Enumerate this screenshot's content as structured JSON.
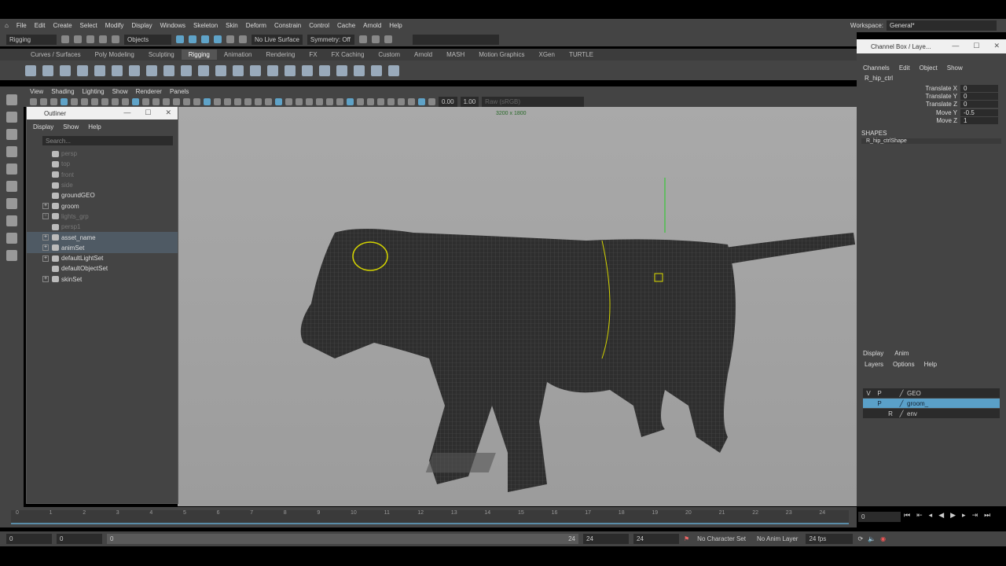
{
  "menubar": {
    "items": [
      "File",
      "Edit",
      "Create",
      "Select",
      "Modify",
      "Display",
      "Windows",
      "Skeleton",
      "Skin",
      "Deform",
      "Constrain",
      "Control",
      "Cache",
      "Arnold",
      "Help"
    ],
    "workspace_label": "Workspace:",
    "workspace_value": "General*"
  },
  "status": {
    "mode": "Rigging",
    "objects": "Objects",
    "live_surface": "No Live Surface",
    "symmetry": "Symmetry: Off"
  },
  "shelf": {
    "tabs": [
      "Curves / Surfaces",
      "Poly Modeling",
      "Sculpting",
      "Rigging",
      "Animation",
      "Rendering",
      "FX",
      "FX Caching",
      "Custom",
      "Arnold",
      "MASH",
      "Motion Graphics",
      "XGen",
      "TURTLE"
    ],
    "active": "Rigging"
  },
  "panel": {
    "menu": [
      "View",
      "Shading",
      "Lighting",
      "Show",
      "Renderer",
      "Panels"
    ],
    "exposure": "0.00",
    "gamma": "1.00",
    "colorspace": "Raw (sRGB)",
    "resolution": "3200 x 1800"
  },
  "outliner": {
    "title": "Outliner",
    "menu": [
      "Display",
      "Show",
      "Help"
    ],
    "search_placeholder": "Search...",
    "items": [
      {
        "label": "persp",
        "dim": true,
        "exp": false
      },
      {
        "label": "top",
        "dim": true,
        "exp": false
      },
      {
        "label": "front",
        "dim": true,
        "exp": false
      },
      {
        "label": "side",
        "dim": true,
        "exp": false
      },
      {
        "label": "groundGEO",
        "dim": false,
        "exp": false
      },
      {
        "label": "groom",
        "dim": false,
        "exp": true
      },
      {
        "label": "lights_grp",
        "dim": true,
        "exp": true
      },
      {
        "label": "persp1",
        "dim": true,
        "exp": false
      },
      {
        "label": "asset_name",
        "dim": false,
        "exp": true,
        "sel": true
      },
      {
        "label": "animSet",
        "dim": false,
        "exp": true,
        "sel": true
      },
      {
        "label": "defaultLightSet",
        "dim": false,
        "exp": true
      },
      {
        "label": "defaultObjectSet",
        "dim": false,
        "exp": false
      },
      {
        "label": "skinSet",
        "dim": false,
        "exp": true
      }
    ]
  },
  "channelbox": {
    "title": "Channel Box / Laye...",
    "menu": [
      "Channels",
      "Edit",
      "Object",
      "Show"
    ],
    "object": "R_hip_ctrl",
    "channels": [
      {
        "label": "Translate X",
        "value": "0"
      },
      {
        "label": "Translate Y",
        "value": "0"
      },
      {
        "label": "Translate Z",
        "value": "0"
      },
      {
        "label": "Move Y",
        "value": "-0.5"
      },
      {
        "label": "Move Z",
        "value": "1"
      }
    ],
    "shapes_label": "SHAPES",
    "shape": "R_hip_ctrlShape",
    "layer_tabs": [
      "Display",
      "Anim"
    ],
    "layer_menu": [
      "Layers",
      "Options",
      "Help"
    ],
    "layers": [
      {
        "v": "V",
        "p": "P",
        "r": "",
        "name": "GEO"
      },
      {
        "v": "",
        "p": "P",
        "r": "",
        "name": "groom_",
        "sel": true
      },
      {
        "v": "",
        "p": "",
        "r": "R",
        "name": "env"
      }
    ]
  },
  "timeline": {
    "ticks": [
      "0",
      "1",
      "2",
      "3",
      "4",
      "5",
      "6",
      "7",
      "8",
      "9",
      "10",
      "11",
      "12",
      "13",
      "14",
      "15",
      "16",
      "17",
      "18",
      "19",
      "20",
      "21",
      "22",
      "23",
      "24"
    ],
    "current": "0"
  },
  "range": {
    "start": "0",
    "anim_start": "0",
    "range_start": "0",
    "range_end": "24",
    "end": "24",
    "anim_end": "24",
    "character_set": "No Character Set",
    "anim_layer": "No Anim Layer",
    "fps": "24 fps"
  },
  "colors": {
    "accent": "#5aa0c8",
    "panel": "#444444",
    "viewport": "#a3a3a3"
  }
}
